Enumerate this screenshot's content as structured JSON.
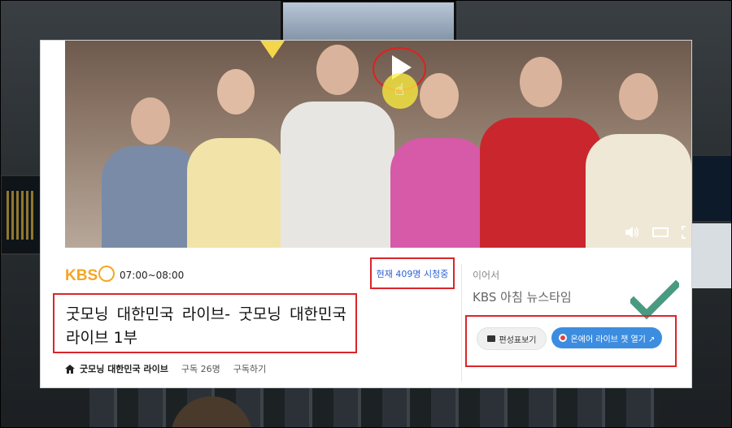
{
  "schedule": {
    "time": "07:00~08:00"
  },
  "brand": {
    "kbs_logo": "KBS"
  },
  "stream": {
    "viewers": "현재 409명 시청중"
  },
  "program": {
    "title": "굿모닝 대한민국 라이브-                          굿모닝 대한민국 라이브 1부",
    "home_name": "굿모닝 대한민국 라이브",
    "subscribers": "구독 26명",
    "subscribe_label": "구독하기"
  },
  "next": {
    "label": "이어서",
    "title": "KBS 아침 뉴스타임"
  },
  "buttons": {
    "schedule_label": "편성표보기",
    "chat_label": "온에어 라이브 챗 열기 ↗"
  },
  "colors": {
    "brand": "#f5a623",
    "accent": "#3c8de0",
    "annotation": "#d9262b",
    "check": "#4a9a82"
  },
  "icons": {
    "play": "play-icon",
    "volume": "volume-icon",
    "theater": "theater-mode-icon",
    "fullscreen": "fullscreen-icon",
    "home": "home-icon",
    "checkmark": "checkmark-icon"
  }
}
